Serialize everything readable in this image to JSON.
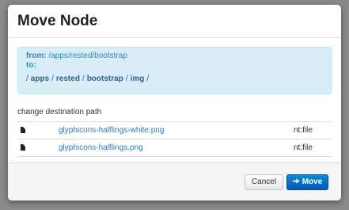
{
  "modal": {
    "title": "Move Node"
  },
  "info": {
    "from_label": "from:",
    "from_value": "/apps/rested/bootstrap",
    "to_label": "to:",
    "path_segments": [
      "apps",
      "rested",
      "bootstrap",
      "img"
    ],
    "separator": "/"
  },
  "section": {
    "label": "change destination path"
  },
  "files": [
    {
      "icon": "file-icon",
      "name": "glyphicons-halflings-white.png",
      "type": "nt:file"
    },
    {
      "icon": "file-icon",
      "name": "glyphicons-halflings.png",
      "type": "nt:file"
    }
  ],
  "footer": {
    "cancel_label": "Cancel",
    "move_label": "Move",
    "move_icon": "arrow-right-icon"
  },
  "colors": {
    "info_bg": "#d9edf7",
    "link": "#3478c0",
    "primary": "#0457b8"
  }
}
